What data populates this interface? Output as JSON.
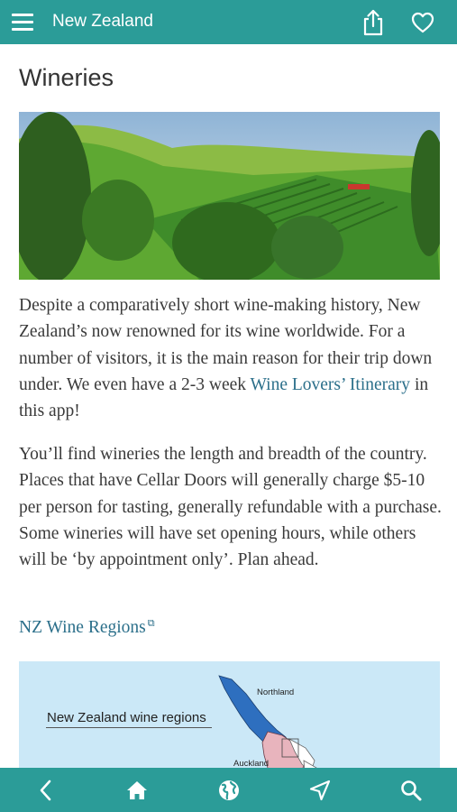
{
  "header": {
    "title": "New Zealand"
  },
  "page": {
    "title": "Wineries",
    "para1_text": "Despite a comparatively short wine-making history, New Zealand’s now renowned for its wine worldwide. For a number of visitors, it is the main reason for their trip down under. We even have a 2-3 week ",
    "para1_link": "Wine Lovers’ Itinerary",
    "para1_after": " in this app!",
    "para2": "You’ll find wineries the length and breadth of the country. Places that have Cellar Doors will generally charge $5-10 per person for tasting, generally refundable with a purchase. Some wineries will have set opening hours, while others will be ‘by appointment only’. Plan ahead.",
    "regions_link": "NZ Wine Regions"
  },
  "map": {
    "title": "New Zealand wine regions",
    "label_northland": "Northland",
    "label_auckland": "Auckland"
  },
  "colors": {
    "accent": "#2b9c98",
    "link": "#2b6f8a"
  },
  "icons": [
    "menu-icon",
    "share-icon",
    "heart-icon",
    "back-icon",
    "home-icon",
    "globe-icon",
    "navigate-icon",
    "search-icon"
  ]
}
